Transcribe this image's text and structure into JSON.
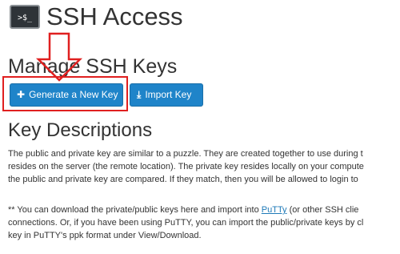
{
  "header": {
    "icon_text": ">$_",
    "title": "SSH Access"
  },
  "manage": {
    "title": "Manage SSH Keys",
    "generate_button": {
      "icon": "plus-icon",
      "label": "Generate a New Key"
    },
    "import_button": {
      "icon": "import-icon",
      "label": "Import Key"
    }
  },
  "descriptions": {
    "title": "Key Descriptions",
    "paragraph1": [
      "The public and private key are similar to a puzzle. They are created together to use during t",
      "resides on the server (the remote location). The private key resides locally on your compute",
      "the public and private key are compared. If they match, then you will be allowed to login to"
    ],
    "paragraph2": {
      "line1_before": "** You can download the private/public keys here and import into ",
      "line1_link": "PuTTy",
      "line1_after": " (or other SSH clie",
      "line2": "connections. Or, if you have been using PuTTY, you can import the public/private keys by cl",
      "line3": "key in PuTTY's ppk format under View/Download."
    }
  },
  "annotation": {
    "color": "#e02020"
  }
}
